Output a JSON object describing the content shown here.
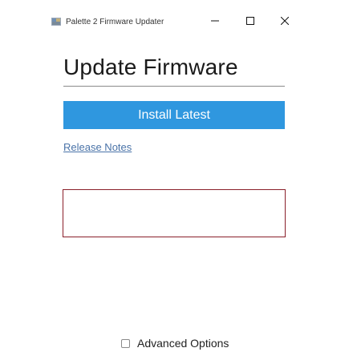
{
  "window": {
    "title": "Palette 2 Firmware Updater",
    "icon": "palette-app-icon",
    "controls": {
      "minimize_icon": "minimize-icon",
      "maximize_icon": "maximize-icon",
      "close_icon": "close-icon"
    }
  },
  "main": {
    "heading": "Update Firmware",
    "install_button_label": "Install Latest",
    "release_notes_link": "Release Notes",
    "log_output": "",
    "advanced_options_label": "Advanced Options",
    "advanced_options_checked": false
  },
  "colors": {
    "accent": "#2f97df",
    "link": "#4a73a8",
    "log_border": "#8a1f2a"
  }
}
